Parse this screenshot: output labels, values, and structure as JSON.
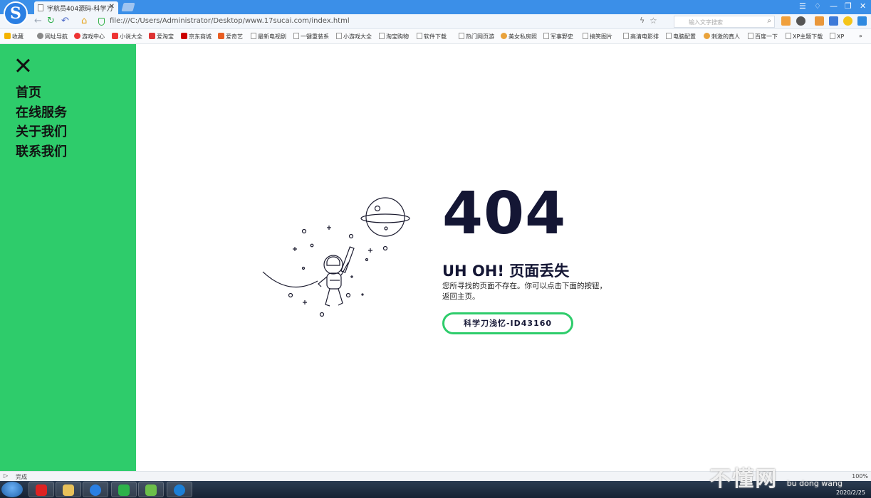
{
  "browser": {
    "tab_title": "宇航员404源码-科学刀",
    "url": "file:///C:/Users/Administrator/Desktop/www.17sucai.com/index.html",
    "search_placeholder": "输入文字搜索",
    "status_text": "完成",
    "zoom": "100%"
  },
  "bookmarks": [
    "收藏",
    "网址导航",
    "游戏中心",
    "小说大全",
    "爱淘宝",
    "京东商城",
    "爱奇艺",
    "最新电视剧",
    "一键重装系",
    "小游戏大全",
    "淘宝购物",
    "软件下载",
    "热门网页游",
    "美女私房照",
    "军事野史",
    "搞笑图片",
    "高清电影排",
    "电脑配置",
    "刺激的真人",
    "百度一下",
    "XP主题下载",
    "XP"
  ],
  "sidebar": {
    "items": [
      {
        "label": "首页"
      },
      {
        "label": "在线服务"
      },
      {
        "label": "关于我们"
      },
      {
        "label": "联系我们"
      }
    ]
  },
  "error": {
    "code": "404",
    "heading": "UH OH! 页面丢失",
    "description": "您所寻找的页面不存在。你可以点击下面的按钮，返回主页。",
    "button_label": "科学刀浅忆-ID43160"
  },
  "taskbar": {
    "date": "2020/2/25"
  },
  "watermark": {
    "text": "不懂网",
    "sub": "bu dong wang"
  },
  "colors": {
    "accent": "#2ecc6b",
    "text_dark": "#141634",
    "titlebar": "#3b8fe8"
  }
}
